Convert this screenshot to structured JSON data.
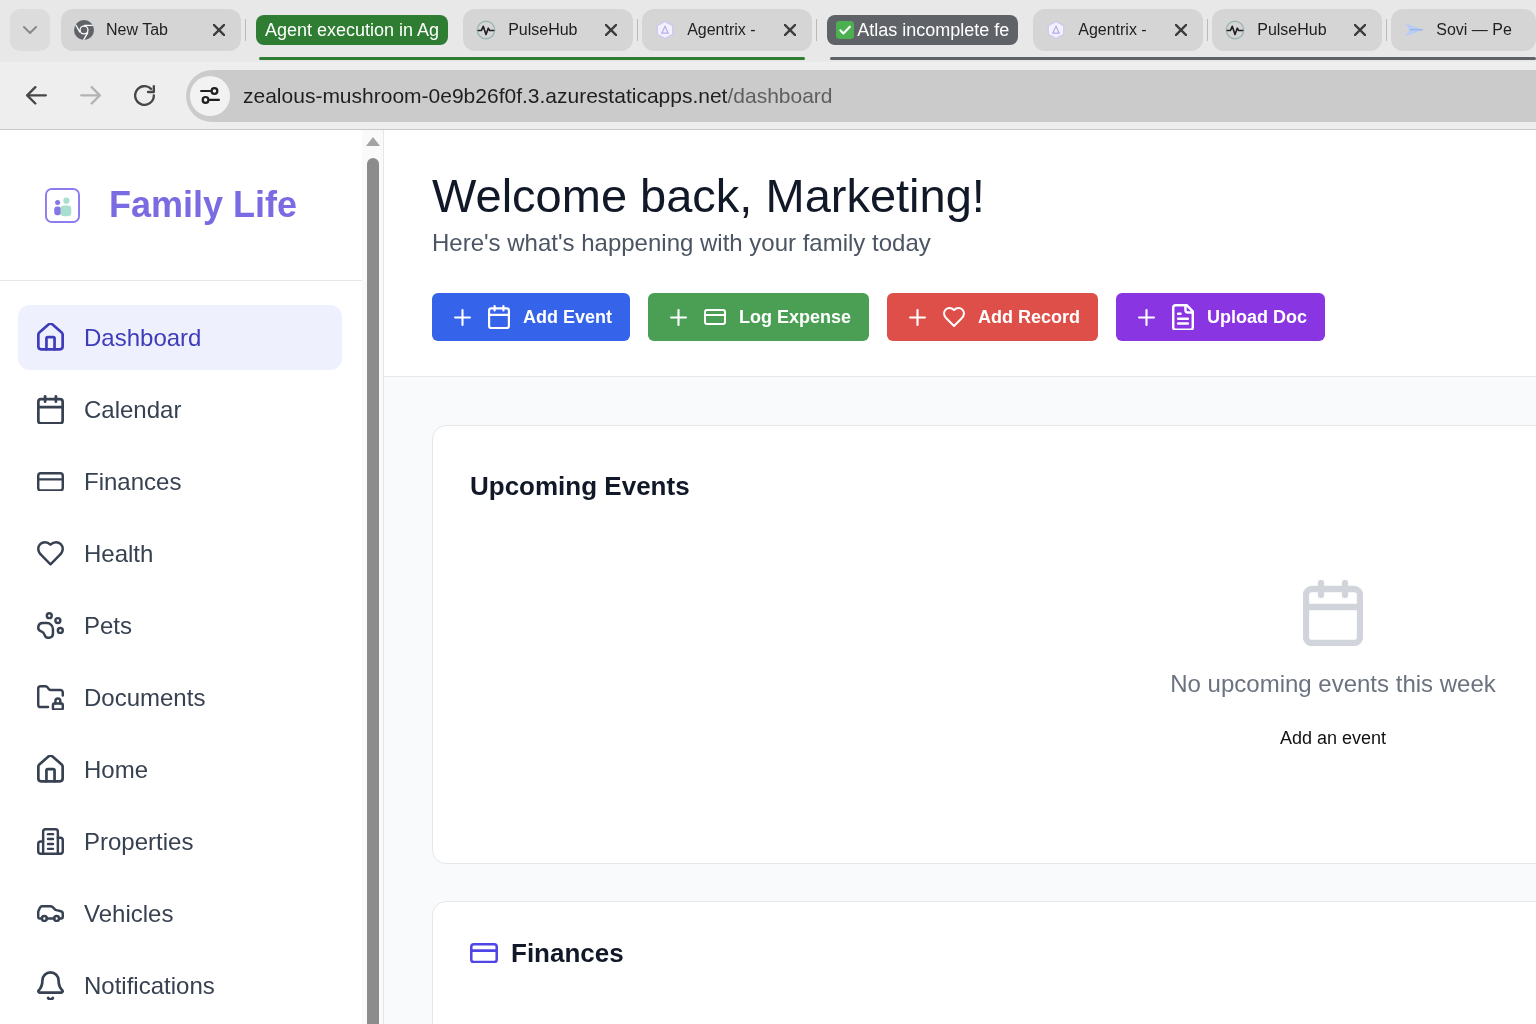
{
  "browser": {
    "tab_strip": {
      "items": [
        {
          "kind": "tab",
          "title": "New Tab",
          "selected": false,
          "close_button": true
        },
        {
          "kind": "group",
          "label": "Agent execution in Ag",
          "color": "#2e7d32",
          "tabs": [
            {
              "title": "PulseHub",
              "selected": false,
              "close_button": true
            },
            {
              "title": "Agentrix -",
              "selected": false,
              "close_button": true
            }
          ]
        },
        {
          "kind": "group",
          "label": "Atlas incomplete fe",
          "color": "#5f6368",
          "tabs": [
            {
              "title": "Agentrix -",
              "selected": false,
              "close_button": true
            },
            {
              "title": "PulseHub",
              "selected": false,
              "close_button": true
            },
            {
              "title": "Sovi — Pe",
              "selected": false,
              "close_button": false
            }
          ]
        }
      ]
    },
    "toolbar": {
      "back": {
        "disabled": false
      },
      "forward": {
        "disabled": true
      },
      "address": {
        "host": "zealous-mushroom-0e9b26f0f.3.azurestaticapps.net",
        "path": "/dashboard"
      }
    }
  },
  "sidebar": {
    "app_name": "Family Life",
    "items": [
      {
        "label": "Dashboard",
        "selected": true
      },
      {
        "label": "Calendar",
        "selected": false
      },
      {
        "label": "Finances",
        "selected": false
      },
      {
        "label": "Health",
        "selected": false
      },
      {
        "label": "Pets",
        "selected": false
      },
      {
        "label": "Documents",
        "selected": false
      },
      {
        "label": "Home",
        "selected": false
      },
      {
        "label": "Properties",
        "selected": false
      },
      {
        "label": "Vehicles",
        "selected": false
      },
      {
        "label": "Notifications",
        "selected": false
      }
    ]
  },
  "header": {
    "title": "Welcome back, Marketing!",
    "subtitle": "Here's what's happening with your family today",
    "actions": [
      {
        "label": "Add Event",
        "color": "#3563e9"
      },
      {
        "label": "Log Expense",
        "color": "#4a9f54"
      },
      {
        "label": "Add Record",
        "color": "#de4f49"
      },
      {
        "label": "Upload Doc",
        "color": "#8a35e2"
      }
    ]
  },
  "cards": [
    {
      "kind": "empty",
      "title": "Upcoming Events",
      "message": "No upcoming events this week",
      "link": "Add an event"
    },
    {
      "kind": "section",
      "title": "Finances"
    }
  ]
}
